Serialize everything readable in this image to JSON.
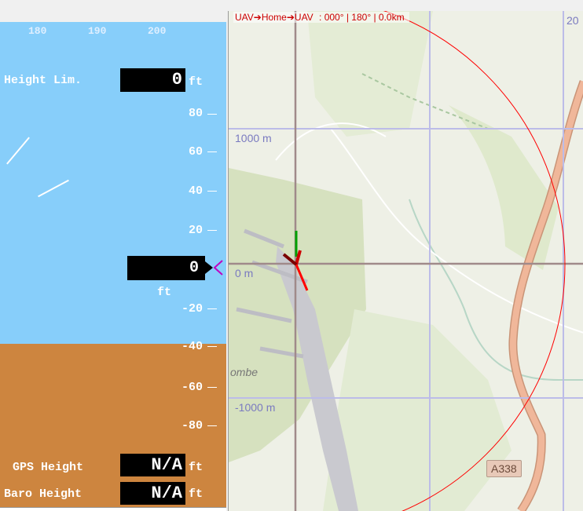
{
  "hud": {
    "heading_scale": [
      "180",
      "190",
      "200"
    ],
    "height_limit": {
      "label": "Height Lim.",
      "value": "0",
      "unit": "ft"
    },
    "altitude_ticks": [
      {
        "label": "80"
      },
      {
        "label": "60"
      },
      {
        "label": "40"
      },
      {
        "label": "20"
      },
      {
        "label": "-20"
      },
      {
        "label": "-40"
      },
      {
        "label": "-60"
      },
      {
        "label": "-80"
      }
    ],
    "altitude": {
      "value": "0",
      "unit": "ft"
    },
    "gps_height": {
      "label": "GPS Height",
      "value": "N/A",
      "unit": "ft"
    },
    "baro_height": {
      "label": "Baro Height",
      "value": "N/A",
      "unit": "ft"
    },
    "colors": {
      "sky": "#87CEFA",
      "ground": "#CD853F"
    }
  },
  "map": {
    "status": {
      "route": "UAV➔Home➔UAV",
      "values": ": 000° | 180° | 0.0km"
    },
    "grid_labels": {
      "north": "1000 m",
      "center": "0 m",
      "south": "-1000 m",
      "east_partial": "20"
    },
    "road_label": "A338",
    "place_partial": "ombe",
    "colors": {
      "range_ring": "#ff0000",
      "grid": "#b9b9e6",
      "crosshair": "#a08a8a",
      "road": "#f0a883"
    }
  }
}
